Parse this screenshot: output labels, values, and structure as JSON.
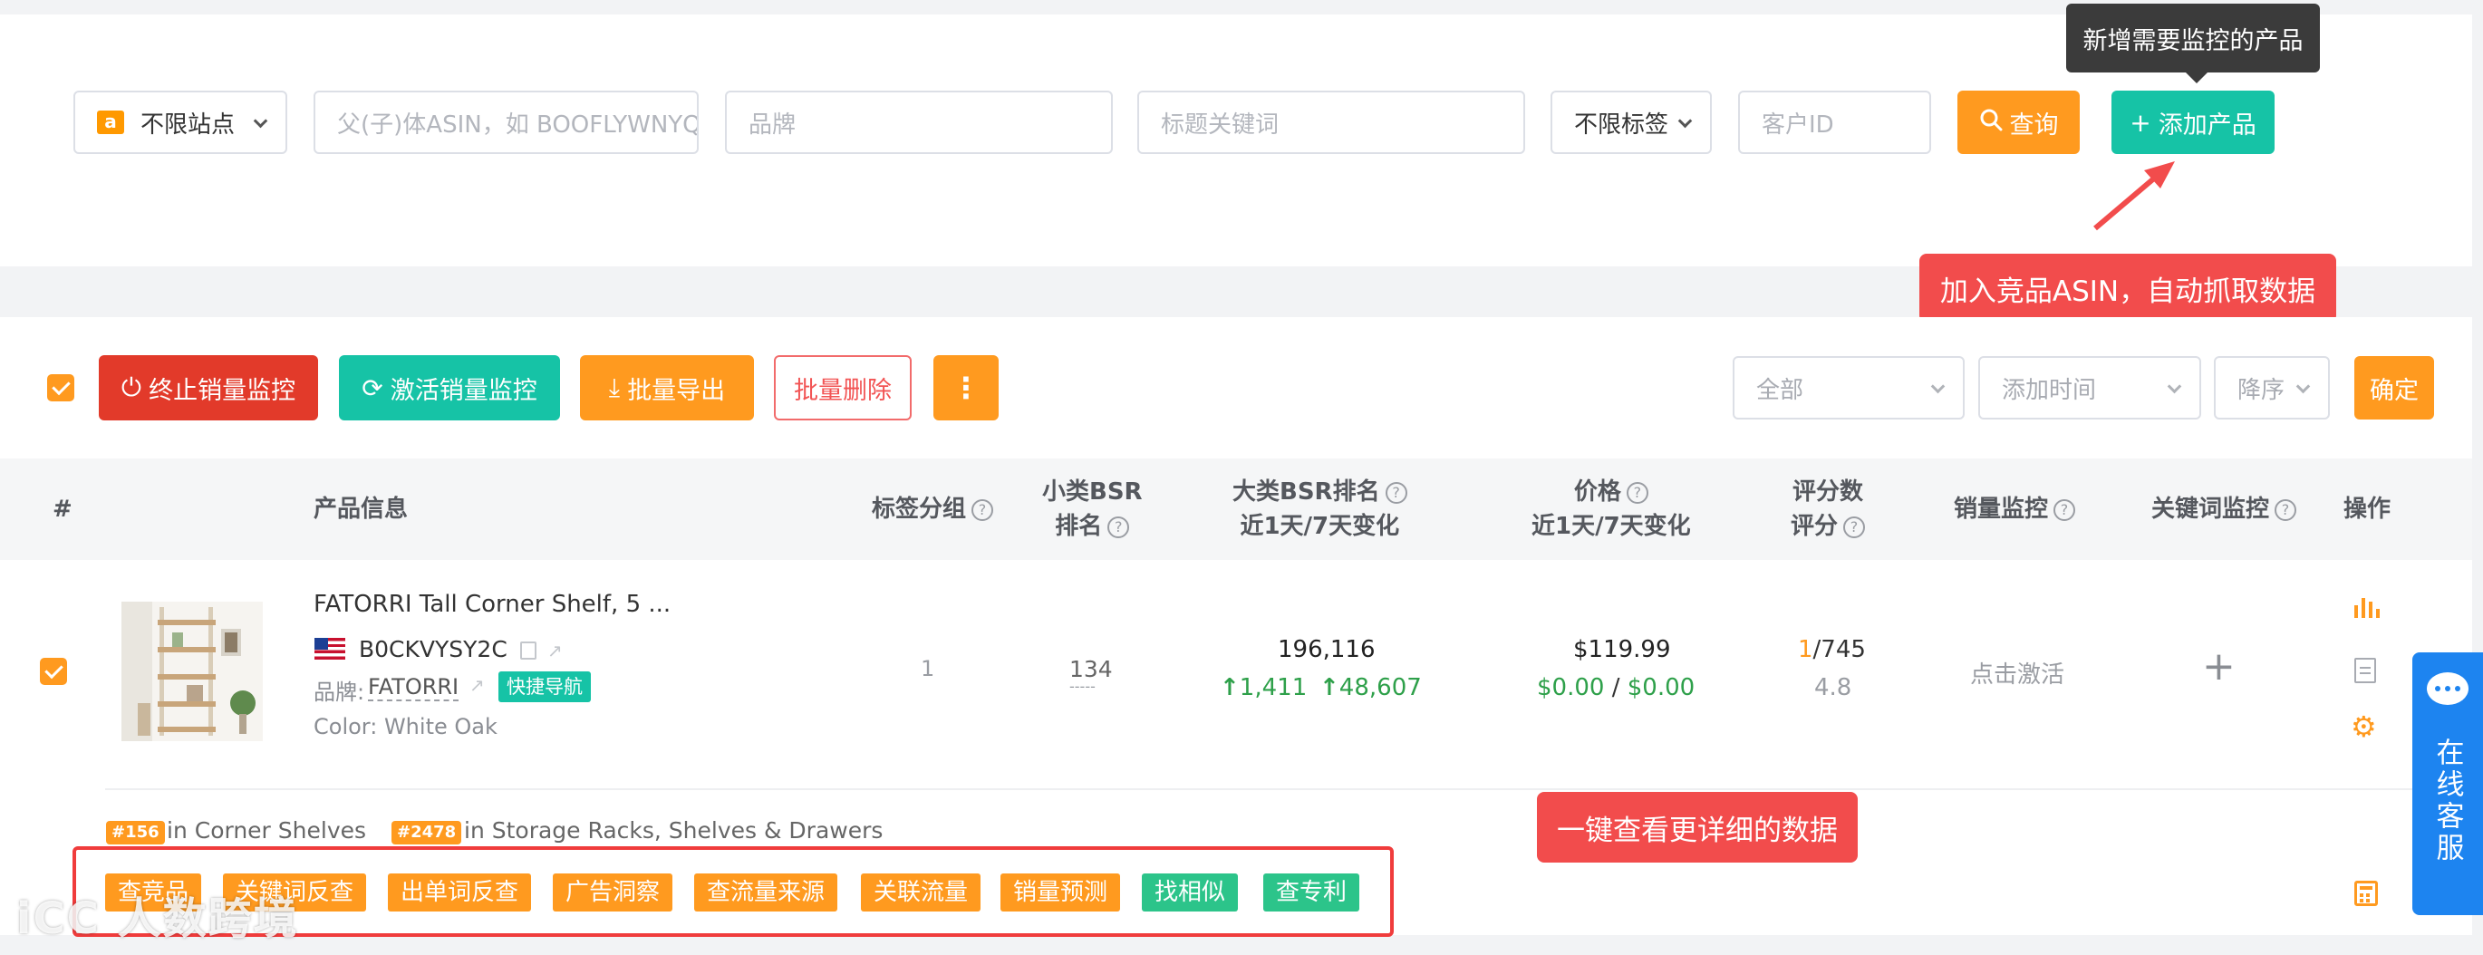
{
  "filters": {
    "site": "不限站点",
    "asin_placeholder": "父(子)体ASIN，如 BOOFLYWNYQ",
    "brand_placeholder": "品牌",
    "title_placeholder": "标题关键词",
    "tag": "不限标签",
    "customer_placeholder": "客户ID",
    "query_label": "查询",
    "add_label": "添加产品"
  },
  "tooltip": "新增需要监控的产品",
  "callout_top": "加入竞品ASIN，自动抓取数据",
  "callout_bottom": "一键查看更详细的数据",
  "toolbar": {
    "stop": "终止销量监控",
    "activate": "激活销量监控",
    "export": "批量导出",
    "delete": "批量删除",
    "more": "⋮",
    "filter_all": "全部",
    "sort_field": "添加时间",
    "sort_order": "降序",
    "confirm": "确定"
  },
  "table_header": {
    "index": "#",
    "product": "产品信息",
    "tag_group": "标签分组",
    "small_bsr_1": "小类BSR",
    "small_bsr_2": "排名",
    "big_bsr_1": "大类BSR排名",
    "big_bsr_2": "近1天/7天变化",
    "price_1": "价格",
    "price_2": "近1天/7天变化",
    "rating_1": "评分数",
    "rating_2": "评分",
    "sales_monitor": "销量监控",
    "keyword_monitor": "关键词监控",
    "actions": "操作"
  },
  "row": {
    "title": "FATORRI Tall Corner Shelf, 5 ...",
    "asin": "B0CKVYSY2C",
    "brand_label": "品牌:",
    "brand": "FATORRI",
    "quick_nav": "快捷导航",
    "color": "Color: White Oak",
    "tag_group": "1",
    "small_bsr": "134",
    "small_bsr_sub": "-----",
    "big_bsr": "196,116",
    "big_bsr_1d": "1,411",
    "big_bsr_7d": "48,607",
    "price": "$119.99",
    "price_1d": "$0.00",
    "price_sep": "/",
    "price_7d": "$0.00",
    "rating_count_a": "1",
    "rating_count_b": "/745",
    "rating": "4.8",
    "sales_monitor": "点击激活",
    "keyword_monitor": "+",
    "rank1_badge": "#156",
    "rank1_text": "in Corner Shelves",
    "rank2_badge": "#2478",
    "rank2_text": "in Storage Racks, Shelves & Drawers"
  },
  "actions": [
    {
      "label": "查竞品",
      "color": "#ff9a1f"
    },
    {
      "label": "关键词反查",
      "color": "#ff9a1f"
    },
    {
      "label": "出单词反查",
      "color": "#ff9a1f"
    },
    {
      "label": "广告洞察",
      "color": "#ff9a1f"
    },
    {
      "label": "查流量来源",
      "color": "#ff9a1f"
    },
    {
      "label": "关联流量",
      "color": "#ff9a1f"
    },
    {
      "label": "销量预测",
      "color": "#ff9a1f"
    },
    {
      "label": "找相似",
      "color": "#2cc48a"
    },
    {
      "label": "查专利",
      "color": "#2cc48a"
    }
  ],
  "chat": "在线客服",
  "watermark": "iCC 人数跨境"
}
